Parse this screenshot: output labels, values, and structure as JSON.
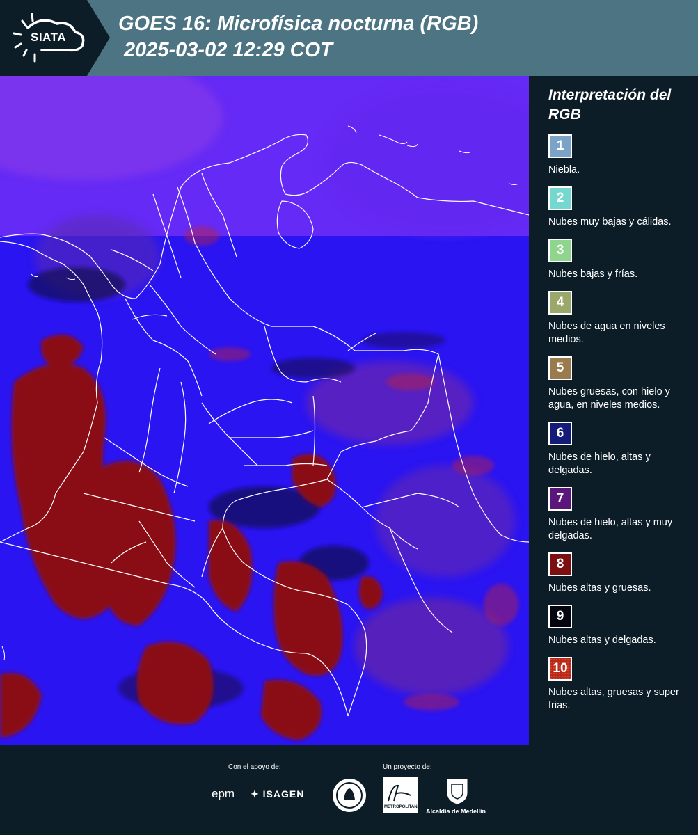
{
  "header": {
    "logo_text": "SIATA",
    "title": "GOES 16: Microfísica nocturna (RGB)",
    "subtitle": "2025-03-02 12:29 COT"
  },
  "legend": {
    "title": "Interpretación del RGB",
    "items": [
      {
        "number": "1",
        "label": "Niebla.",
        "color": "#7ba3c8"
      },
      {
        "number": "2",
        "label": "Nubes muy bajas y cálidas.",
        "color": "#75d8d0"
      },
      {
        "number": "3",
        "label": "Nubes bajas y frías.",
        "color": "#8fd58e"
      },
      {
        "number": "4",
        "label": "Nubes de agua en niveles medios.",
        "color": "#9aa86c"
      },
      {
        "number": "5",
        "label": "Nubes gruesas, con hielo y agua, en niveles medios.",
        "color": "#9a7b4e"
      },
      {
        "number": "6",
        "label": "Nubes de hielo, altas y delgadas.",
        "color": "#141b78"
      },
      {
        "number": "7",
        "label": "Nubes de hielo, altas y muy delgadas.",
        "color": "#5a167a"
      },
      {
        "number": "8",
        "label": "Nubes altas y gruesas.",
        "color": "#7c0f0f"
      },
      {
        "number": "9",
        "label": "Nubes altas y delgadas.",
        "color": "#050510"
      },
      {
        "number": "10",
        "label": "Nubes altas, gruesas y super frias.",
        "color": "#b52a1a"
      }
    ]
  },
  "footer": {
    "support_label": "Con el apoyo de:",
    "project_label": "Un proyecto de:",
    "sponsors": [
      "epm",
      "ISAGEN"
    ],
    "partners": [
      "Área Metropolitana Valle de Aburrá",
      "Alcaldía de Medellín"
    ],
    "area_caption": "METROPOLITANA",
    "alcaldia_caption": "Alcaldía de Medellín"
  }
}
